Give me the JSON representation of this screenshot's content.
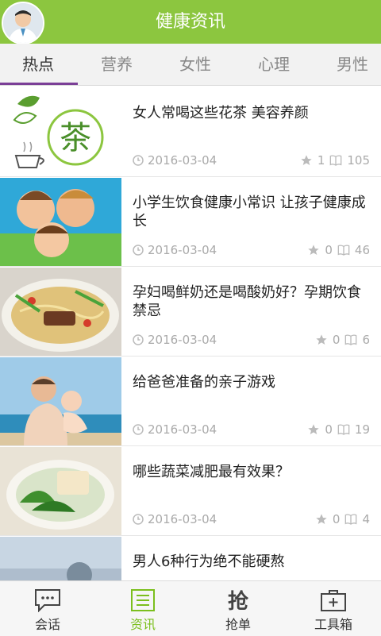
{
  "header": {
    "title": "健康资讯"
  },
  "tabs": [
    "热点",
    "营养",
    "女性",
    "心理",
    "男性"
  ],
  "articles": [
    {
      "title": "女人常喝这些花茶 美容养颜",
      "date": "2016-03-04",
      "stars": "1",
      "views": "105",
      "thumb": "tea-logo"
    },
    {
      "title": "小学生饮食健康小常识 让孩子健康成长",
      "date": "2016-03-04",
      "stars": "0",
      "views": "46",
      "thumb": "children"
    },
    {
      "title": "孕妇喝鲜奶还是喝酸奶好？孕期饮食禁忌",
      "date": "2016-03-04",
      "stars": "0",
      "views": "6",
      "thumb": "noodles"
    },
    {
      "title": "给爸爸准备的亲子游戏",
      "date": "2016-03-04",
      "stars": "0",
      "views": "19",
      "thumb": "father-baby"
    },
    {
      "title": "哪些蔬菜减肥最有效果？",
      "date": "2016-03-04",
      "stars": "0",
      "views": "4",
      "thumb": "vegetable-soup"
    },
    {
      "title": "男人6种行为绝不能硬熬",
      "date": "",
      "stars": "",
      "views": "",
      "thumb": "man"
    }
  ],
  "bottom_nav": [
    {
      "label": "会话",
      "icon": "chat-icon"
    },
    {
      "label": "资讯",
      "icon": "news-icon"
    },
    {
      "label": "抢单",
      "icon": "grab-order-icon"
    },
    {
      "label": "工具箱",
      "icon": "toolbox-icon"
    }
  ],
  "colors": {
    "header": "#8cc63f",
    "tab_accent": "#7b3f97",
    "nav_active": "#7bbf1d"
  }
}
